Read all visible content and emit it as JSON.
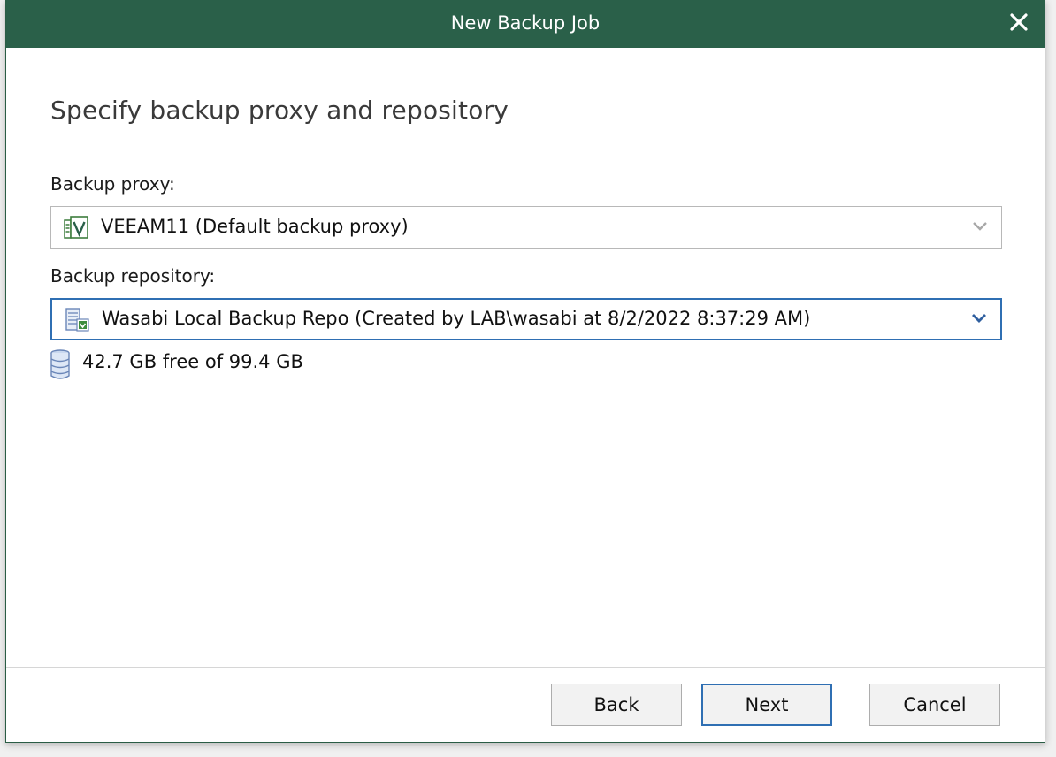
{
  "window": {
    "title": "New Backup Job"
  },
  "page": {
    "heading": "Specify backup proxy and repository"
  },
  "proxy": {
    "label": "Backup proxy:",
    "selected": "VEEAM11 (Default backup proxy)",
    "icon": "veeam-proxy-icon"
  },
  "repository": {
    "label": "Backup repository:",
    "selected": "Wasabi Local Backup Repo (Created by LAB\\wasabi at 8/2/2022 8:37:29 AM)",
    "icon": "repository-server-icon",
    "free_space": "42.7 GB free of 99.4 GB"
  },
  "buttons": {
    "back": "Back",
    "next": "Next",
    "cancel": "Cancel"
  },
  "colors": {
    "titlebar": "#2a6049",
    "focus": "#2f6fb3"
  }
}
